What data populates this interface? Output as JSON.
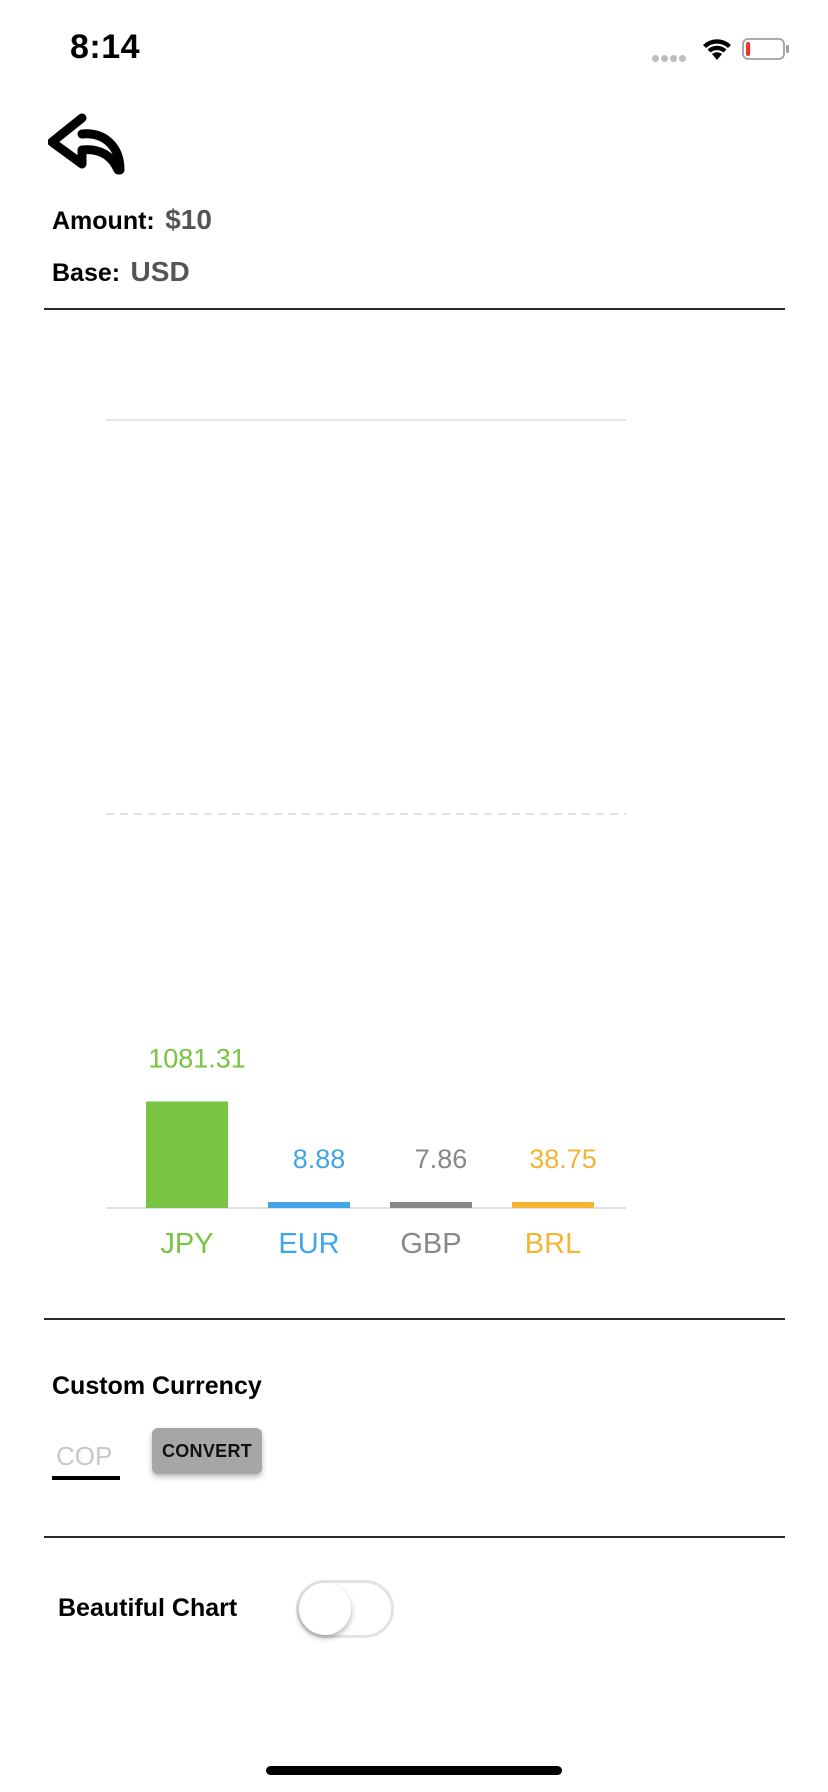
{
  "status_bar": {
    "time": "8:14",
    "signal_icon": "signal-dots-icon",
    "wifi_icon": "wifi-icon",
    "battery_icon": "battery-low-icon",
    "battery_level_fraction": 0.12,
    "battery_color": "#e53935"
  },
  "header": {
    "back_icon": "reply-arrow-icon",
    "amount_label": "Amount:",
    "amount_value": "$10",
    "base_label": "Base:",
    "base_value": "USD"
  },
  "chart_data": {
    "type": "bar",
    "categories": [
      "JPY",
      "EUR",
      "GBP",
      "BRL"
    ],
    "values": [
      1081.31,
      8.88,
      7.86,
      38.75
    ],
    "value_labels": [
      "1081.31",
      "8.88",
      "7.86",
      "38.75"
    ],
    "colors": [
      "#78c442",
      "#41a5e8",
      "#888888",
      "#f4b434"
    ],
    "grid": true,
    "gridlines": "solid top, dashed middle",
    "ylim": [
      0,
      8000
    ],
    "title": "",
    "xlabel": "",
    "ylabel": ""
  },
  "custom_currency": {
    "title": "Custom Currency",
    "input_placeholder": "COP",
    "input_value": "",
    "convert_label": "CONVERT"
  },
  "beautiful_chart": {
    "label": "Beautiful Chart",
    "enabled": false
  }
}
